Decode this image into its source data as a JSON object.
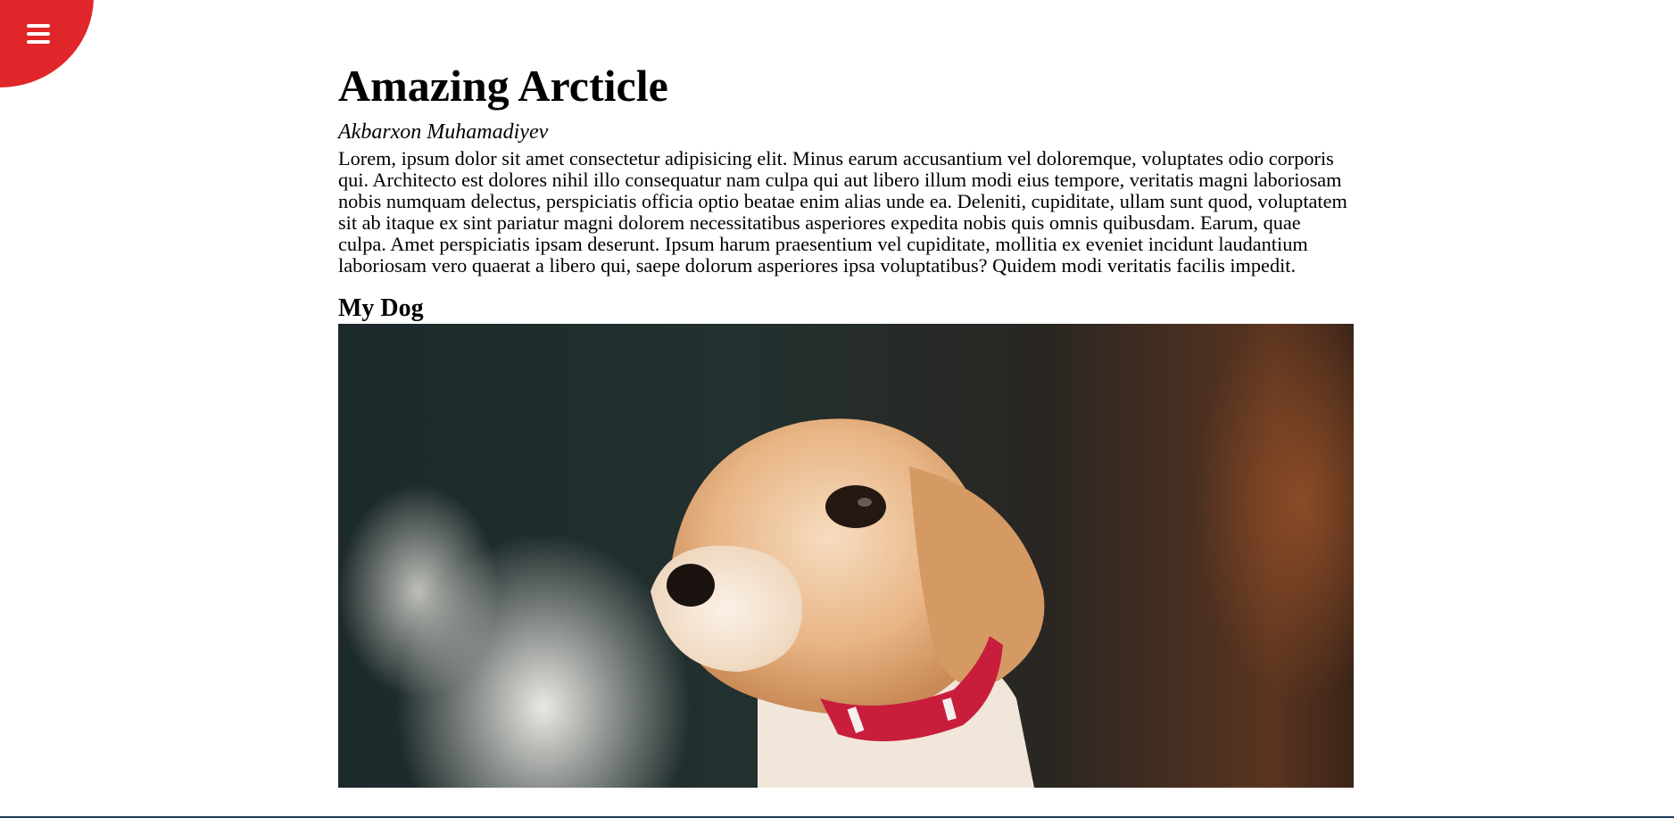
{
  "menu": {
    "icon": "hamburger-menu-icon",
    "accent_color": "#e0262a"
  },
  "article": {
    "title": "Amazing Arcticle",
    "author": "Akbarxon Muhamadiyev",
    "body": "Lorem, ipsum dolor sit amet consectetur adipisicing elit. Minus earum accusantium vel doloremque, voluptates odio corporis qui. Architecto est dolores nihil illo consequatur nam culpa qui aut libero illum modi eius tempore, veritatis magni laboriosam nobis numquam delectus, perspiciatis officia optio beatae enim alias unde ea. Deleniti, cupiditate, ullam sunt quod, voluptatem sit ab itaque ex sint pariatur magni dolorem necessitatibus asperiores expedita nobis quis omnis quibusdam. Earum, quae culpa. Amet perspiciatis ipsam deserunt. Ipsum harum praesentium vel cupiditate, mollitia ex eveniet incidunt laudantium laboriosam vero quaerat a libero qui, saepe dolorum asperiores ipsa voluptatibus? Quidem modi veritatis facilis impedit.",
    "section_heading": "My Dog"
  }
}
